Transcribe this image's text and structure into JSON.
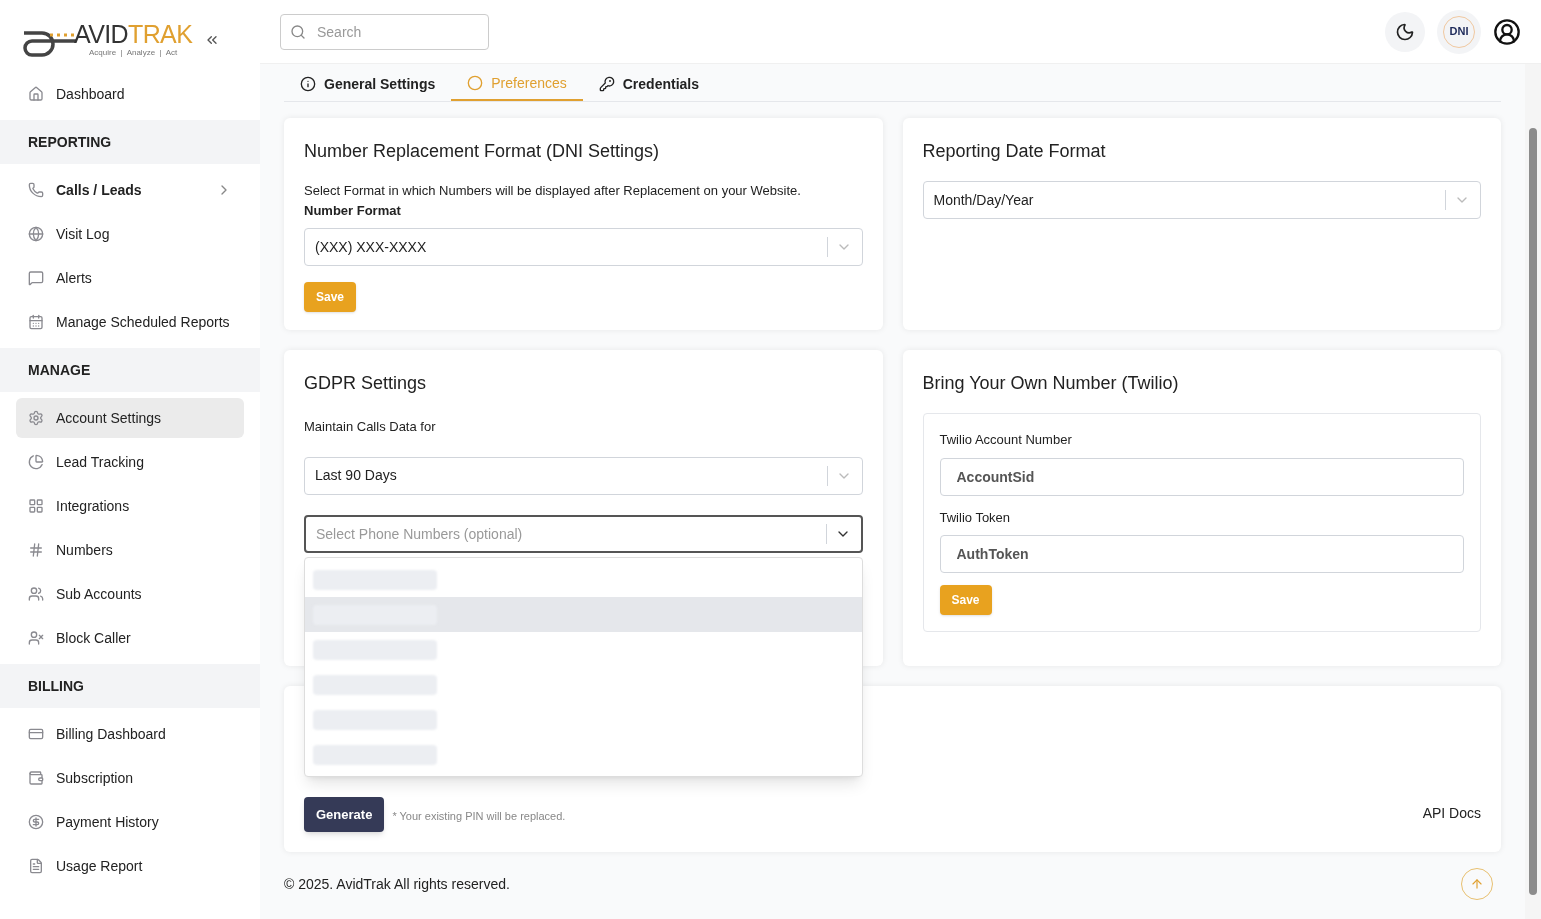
{
  "sidebar": {
    "logo": {
      "brand_dark": "AVID",
      "brand_accent": "TRAK",
      "tagline": "Acquire  |  Analyze  |  Act"
    },
    "sections": [
      {
        "items": [
          {
            "label": "Dashboard",
            "selected": false,
            "kind": "link"
          }
        ]
      },
      {
        "heading": "REPORTING",
        "items": [
          {
            "label": "Calls / Leads",
            "selected": false,
            "kind": "group"
          },
          {
            "label": "Visit Log",
            "selected": false,
            "kind": "link"
          },
          {
            "label": "Alerts",
            "selected": false,
            "kind": "link"
          },
          {
            "label": "Manage Scheduled Reports",
            "selected": false,
            "kind": "link"
          }
        ]
      },
      {
        "heading": "MANAGE",
        "items": [
          {
            "label": "Account Settings",
            "selected": true,
            "kind": "link"
          },
          {
            "label": "Lead Tracking",
            "selected": false,
            "kind": "link"
          },
          {
            "label": "Integrations",
            "selected": false,
            "kind": "link"
          },
          {
            "label": "Numbers",
            "selected": false,
            "kind": "link"
          },
          {
            "label": "Sub Accounts",
            "selected": false,
            "kind": "link"
          },
          {
            "label": "Block Caller",
            "selected": false,
            "kind": "link"
          }
        ]
      },
      {
        "heading": "BILLING",
        "items": [
          {
            "label": "Billing Dashboard",
            "selected": false,
            "kind": "link"
          },
          {
            "label": "Subscription",
            "selected": false,
            "kind": "link"
          },
          {
            "label": "Payment History",
            "selected": false,
            "kind": "link"
          },
          {
            "label": "Usage Report",
            "selected": false,
            "kind": "link"
          }
        ]
      }
    ]
  },
  "header": {
    "search": {
      "placeholder": "Search"
    },
    "badge": "DNI"
  },
  "tabs": [
    {
      "label": "General Settings",
      "selected": false
    },
    {
      "label": "Preferences",
      "selected": true
    },
    {
      "label": "Credentials",
      "selected": false
    }
  ],
  "dni": {
    "title": "Number Replacement Format (DNI Settings)",
    "description": "Select Format in which Numbers will be displayed after Replacement on your Website.",
    "field_label": "Number Format",
    "value": "(XXX) XXX-XXXX",
    "button": "Save"
  },
  "date_format": {
    "title": "Reporting Date Format",
    "value": "Month/Day/Year"
  },
  "gdpr": {
    "title": "GDPR Settings",
    "field_label": "Maintain Calls Data for",
    "value": "Last 90 Days",
    "phones": {
      "placeholder": "Select Phone Numbers (optional)",
      "open": true,
      "options": [
        {
          "highlighted": false
        },
        {
          "highlighted": true
        },
        {
          "highlighted": false
        },
        {
          "highlighted": false
        },
        {
          "highlighted": false
        },
        {
          "highlighted": false
        }
      ]
    }
  },
  "twilio": {
    "title": "Bring Your Own Number (Twilio)",
    "fields": [
      {
        "label": "Twilio Account Number",
        "placeholder": "AccountSid"
      },
      {
        "label": "Twilio Token",
        "placeholder": "AuthToken"
      }
    ],
    "button": "Save"
  },
  "pin": {
    "button": "Generate",
    "note": "* Your existing PIN will be replaced.",
    "link": "API Docs"
  },
  "footer": "© 2025. AvidTrak All rights reserved."
}
